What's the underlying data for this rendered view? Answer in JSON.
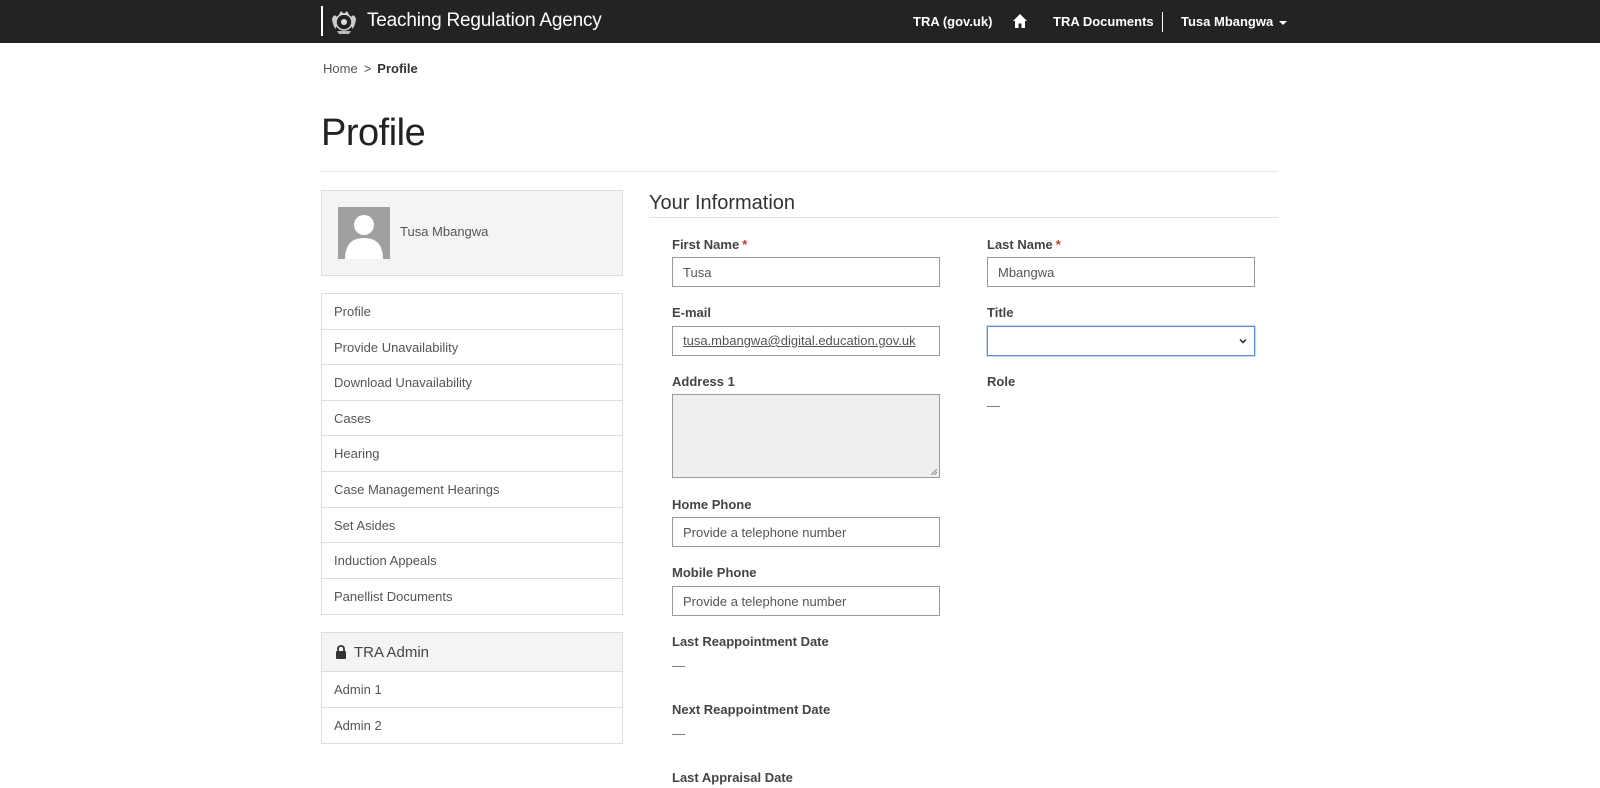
{
  "header": {
    "brand": "Teaching Regulation Agency",
    "nav": {
      "gov_link": "TRA (gov.uk)",
      "documents": "TRA Documents",
      "user": "Tusa Mbangwa"
    }
  },
  "breadcrumb": {
    "home": "Home",
    "separator": ">",
    "current": "Profile"
  },
  "page": {
    "title": "Profile"
  },
  "sidebar": {
    "profile_name": "Tusa Mbangwa",
    "menu": [
      "Profile",
      "Provide Unavailability",
      "Download Unavailability",
      "Cases",
      "Hearing",
      "Case Management Hearings",
      "Set Asides",
      "Induction Appeals",
      "Panellist Documents"
    ],
    "admin": {
      "title": "TRA Admin",
      "items": [
        "Admin 1",
        "Admin 2"
      ]
    }
  },
  "form": {
    "section_title": "Your Information",
    "first_name": {
      "label": "First Name",
      "required_mark": "*",
      "value": "Tusa"
    },
    "last_name": {
      "label": "Last Name",
      "required_mark": "*",
      "value": "Mbangwa"
    },
    "email": {
      "label": "E-mail",
      "value": "tusa.mbangwa@digital.education.gov.uk"
    },
    "title": {
      "label": "Title",
      "value": ""
    },
    "address1": {
      "label": "Address 1",
      "value": ""
    },
    "role": {
      "label": "Role",
      "value": "—"
    },
    "home_phone": {
      "label": "Home Phone",
      "placeholder": "Provide a telephone number"
    },
    "mobile_phone": {
      "label": "Mobile Phone",
      "placeholder": "Provide a telephone number"
    },
    "last_reappointment": {
      "label": "Last Reappointment Date",
      "value": "—"
    },
    "next_reappointment": {
      "label": "Next Reappointment Date",
      "value": "—"
    },
    "last_appraisal": {
      "label": "Last Appraisal Date"
    }
  },
  "colors": {
    "topbar": "#232323",
    "required": "#c0392b",
    "focus": "#5b8fd6"
  }
}
